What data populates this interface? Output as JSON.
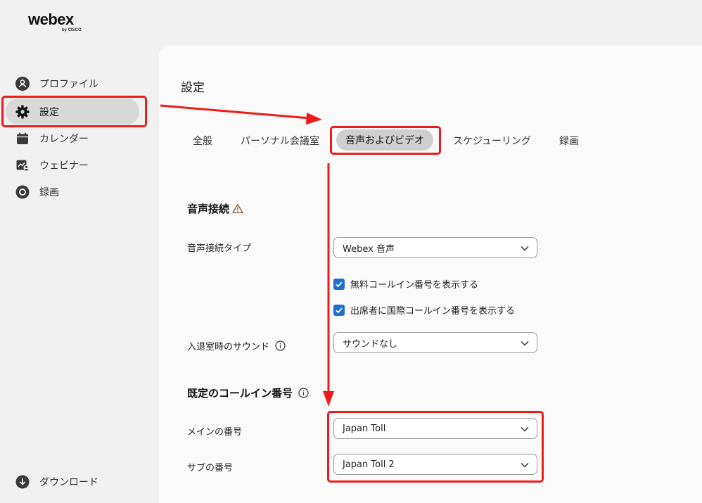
{
  "brand": {
    "logo": "webex",
    "logo_sub": "by CISCO"
  },
  "sidebar": {
    "items": [
      {
        "label": "プロファイル",
        "icon": "profile-icon"
      },
      {
        "label": "設定",
        "icon": "gear-icon",
        "active": true
      },
      {
        "label": "カレンダー",
        "icon": "calendar-icon"
      },
      {
        "label": "ウェビナー",
        "icon": "webinar-icon"
      },
      {
        "label": "録画",
        "icon": "record-icon"
      }
    ],
    "download": "ダウンロード"
  },
  "page": {
    "title": "設定"
  },
  "tabs": [
    {
      "label": "全般"
    },
    {
      "label": "パーソナル会議室"
    },
    {
      "label": "音声およびビデオ",
      "active": true
    },
    {
      "label": "スケジューリング"
    },
    {
      "label": "録画"
    }
  ],
  "audio": {
    "heading": "音声接続",
    "connection_type_label": "音声接続タイプ",
    "connection_type_value": "Webex 音声",
    "checkbox_toll_free": "無料コールイン番号を表示する",
    "checkbox_international": "出席者に国際コールイン番号を表示する",
    "entry_sound_label": "入退室時のサウンド",
    "entry_sound_value": "サウンドなし"
  },
  "callin": {
    "heading": "既定のコールイン番号",
    "main_label": "メインの番号",
    "main_value": "Japan Toll",
    "sub_label": "サブの番号",
    "sub_value": "Japan Toll 2"
  },
  "colors": {
    "highlight": "#ee1b1b",
    "checkbox": "#1f6fd1",
    "active_bg": "#d8d8d8"
  }
}
